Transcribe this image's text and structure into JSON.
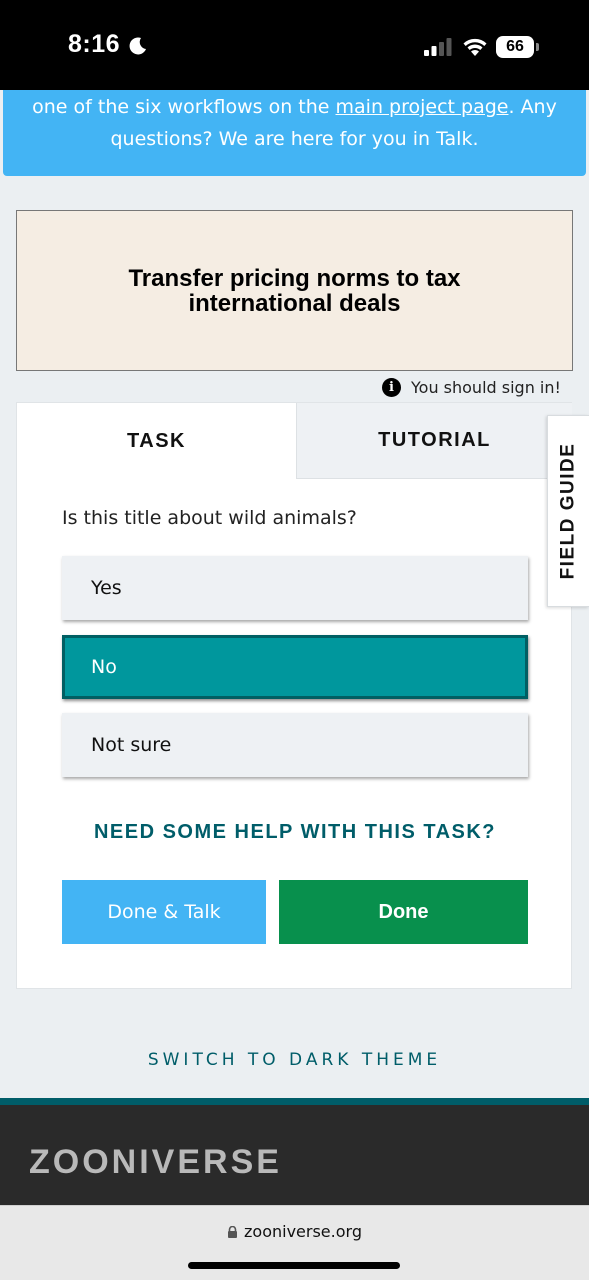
{
  "status_bar": {
    "time": "8:16",
    "battery": "66"
  },
  "banner": {
    "text_before": "one of the six workflows on the ",
    "link": "main project page",
    "text_after": ". Any questions? We are here for you in Talk."
  },
  "subject": {
    "title_line1": "Transfer pricing norms to tax",
    "title_line2": "international deals"
  },
  "sign_in_notice": "You should sign in!",
  "tabs": {
    "task": "TASK",
    "tutorial": "TUTORIAL"
  },
  "task": {
    "question": "Is this title about wild animals?",
    "answers": [
      {
        "label": "Yes",
        "selected": false
      },
      {
        "label": "No",
        "selected": true
      },
      {
        "label": "Not sure",
        "selected": false
      }
    ],
    "help_link": "NEED SOME HELP WITH THIS TASK?",
    "done_talk_label": "Done & Talk",
    "done_label": "Done"
  },
  "field_guide_label": "FIELD GUIDE",
  "switch_theme": "SWITCH TO DARK THEME",
  "footer": {
    "logo": "ZOONIVERSE"
  },
  "browser": {
    "url": "zooniverse.org"
  },
  "colors": {
    "banner": "#43b4f4",
    "selected_answer": "#00979d",
    "done_button": "#08904d",
    "done_talk_button": "#43b4f4",
    "accent_teal": "#005d69"
  }
}
